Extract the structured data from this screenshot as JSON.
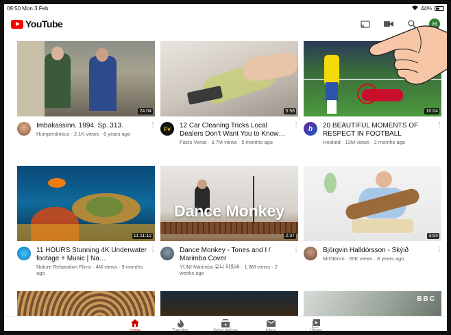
{
  "status": {
    "time": "09:50",
    "date": "Mon 3 Feb",
    "battery": "44%"
  },
  "app": {
    "brand": "YouTube"
  },
  "user": {
    "initial": "H"
  },
  "videos": [
    {
      "title": "Imbakassinn. 1994. Sp. 313.",
      "channel": "Humperdinkus · 2.1K views · 6 years ago",
      "duration": "24:04"
    },
    {
      "title": "12 Car Cleaning Tricks Local Dealers Don't Want You to Know…",
      "channel": "Facts Verse · 3.7M views · 5 months ago",
      "duration": "5:58",
      "avatar_text": "Fv"
    },
    {
      "title": "20 BEAUTIFUL MOMENTS OF RESPECT IN FOOTBALL",
      "channel": "Hooked · 13M views · 2 months ago",
      "duration": "10:04",
      "avatar_text": "h"
    },
    {
      "title": "11 HOURS Stunning 4K Underwater footage + Music | Na…",
      "channel": "Nature Relaxation Films · 4M views · 9 months ago",
      "duration": "11:11:12"
    },
    {
      "title": "Dance Monkey - Tones and I / Marimba Cover",
      "channel": "YUNI Marimba 유니 마림바 · 1.8M views · 2 weeks ago",
      "duration": "2:37",
      "overlay": "Dance Monkey"
    },
    {
      "title": "Björgvin Halldórsson - Skýið",
      "channel": "MrOteron · 50K views · 8 years ago",
      "duration": "3:04"
    }
  ],
  "partial_thumb_text": "BBC",
  "nav": [
    {
      "label": "Home",
      "icon": "home-icon",
      "active": true
    },
    {
      "label": "Trending",
      "icon": "trending-icon"
    },
    {
      "label": "Subscriptions",
      "icon": "subscriptions-icon"
    },
    {
      "label": "Inbox",
      "icon": "inbox-icon"
    },
    {
      "label": "Library",
      "icon": "library-icon"
    }
  ],
  "colors": {
    "brand_red": "#ff0000",
    "active_nav": "#cc0000",
    "avatar_bg": "#2e7d32"
  }
}
